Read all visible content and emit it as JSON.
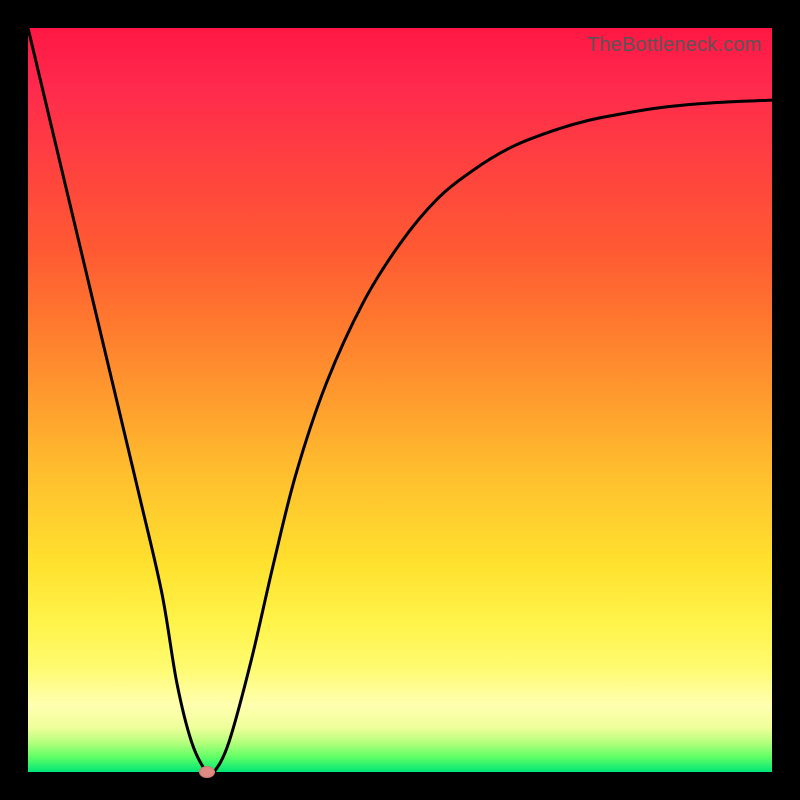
{
  "watermark": "TheBottleneck.com",
  "chart_data": {
    "type": "line",
    "title": "",
    "xlabel": "",
    "ylabel": "",
    "xlim": [
      0,
      100
    ],
    "ylim": [
      0,
      100
    ],
    "grid": false,
    "legend": false,
    "background_gradient": {
      "top_color": "#ff1744",
      "bottom_color": "#00e676",
      "meaning": "top=high bottleneck, bottom=low bottleneck"
    },
    "series": [
      {
        "name": "bottleneck-curve",
        "color": "#000000",
        "x": [
          0,
          5,
          10,
          15,
          18,
          20,
          22,
          24,
          25,
          27,
          30,
          33,
          36,
          40,
          45,
          50,
          55,
          60,
          65,
          70,
          75,
          80,
          85,
          90,
          95,
          100
        ],
        "y": [
          100,
          79,
          58,
          37,
          24,
          12,
          4,
          0,
          0,
          4,
          15,
          28,
          40,
          52,
          63,
          71,
          77,
          81,
          84,
          86,
          87.5,
          88.5,
          89.3,
          89.8,
          90.1,
          90.3
        ]
      }
    ],
    "marker": {
      "name": "optimal-point",
      "x": 24,
      "y": 0,
      "color": "#e08a84"
    }
  }
}
